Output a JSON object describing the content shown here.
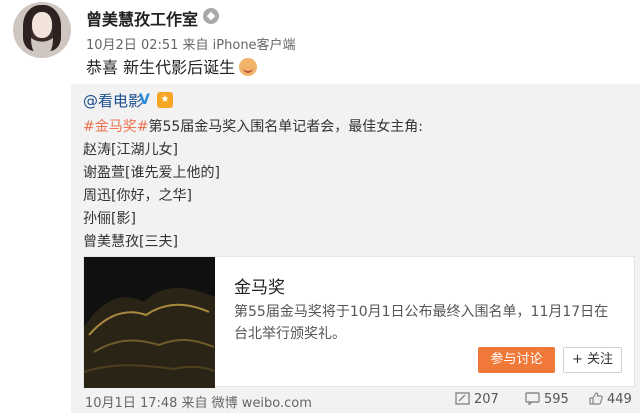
{
  "post": {
    "author": "曾美慧孜工作室",
    "badge_icon": "member-icon",
    "meta": "10月2日 02:51 来自 iPhone客户端",
    "text": "恭喜 新生代影后诞生",
    "emoji_icon": "celebrate-emoji"
  },
  "repost": {
    "author": "@看电影",
    "hashtag": "#金马奖#",
    "intro": "第55届金马奖入围名单记者会，最佳女主角:",
    "nominees": [
      "赵涛[江湖儿女]",
      "谢盈萱[谁先爱上他的]",
      "周迅[你好，之华]",
      "孙俪[影]",
      "曾美慧孜[三夫]"
    ],
    "card": {
      "title": "金马奖",
      "description": "第55届金马奖将于10月1日公布最终入围名单，11月17日在台北举行颁奖礼。",
      "join_label": "参与讨论",
      "follow_label": "+ 关注"
    },
    "footer": {
      "meta": "10月1日 17:48 来自 微博 weibo.com",
      "repost_count": "207",
      "comment_count": "595",
      "like_count": "449"
    }
  },
  "colors": {
    "link": "#1a4e8f",
    "hashtag": "#eb7350",
    "accent_button": "#f0793a"
  }
}
